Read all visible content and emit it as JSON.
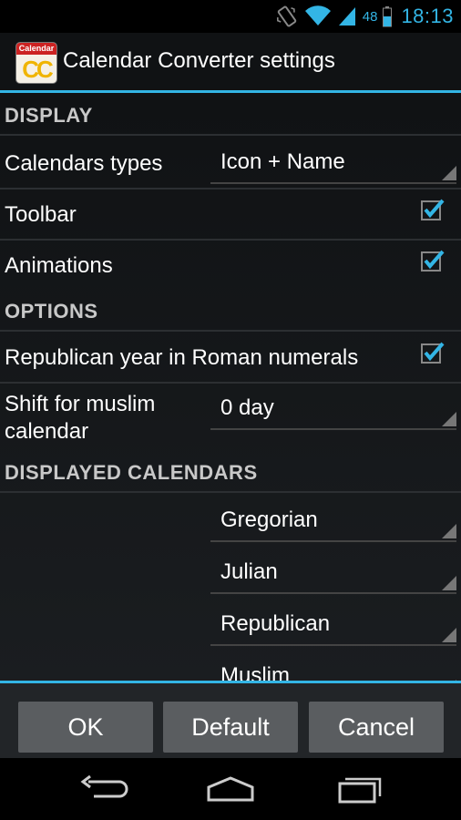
{
  "status_bar": {
    "battery_level": "48",
    "time": "18:13",
    "icons": [
      "vibrate-icon",
      "wifi-icon",
      "signal-icon",
      "battery-icon"
    ]
  },
  "title_bar": {
    "app_icon_band": "Calendar",
    "app_icon_letters": "CC",
    "title": "Calendar Converter settings"
  },
  "display": {
    "header": "DISPLAY",
    "calendar_types_label": "Calendars types",
    "calendar_types_value": "Icon + Name",
    "toolbar_label": "Toolbar",
    "toolbar_checked": true,
    "animations_label": "Animations",
    "animations_checked": true
  },
  "options": {
    "header": "OPTIONS",
    "roman_label": "Republican year in Roman numerals",
    "roman_checked": true,
    "shift_label_line1": "Shift for muslim",
    "shift_label_line2": "calendar",
    "shift_value": "0 day"
  },
  "displayed_calendars": {
    "header": "DISPLAYED CALENDARS",
    "items": [
      "Gregorian",
      "Julian",
      "Republican",
      "Muslim"
    ]
  },
  "buttons": {
    "ok": "OK",
    "default": "Default",
    "cancel": "Cancel"
  },
  "colors": {
    "accent": "#33b5e5",
    "button": "#5a5d60"
  }
}
